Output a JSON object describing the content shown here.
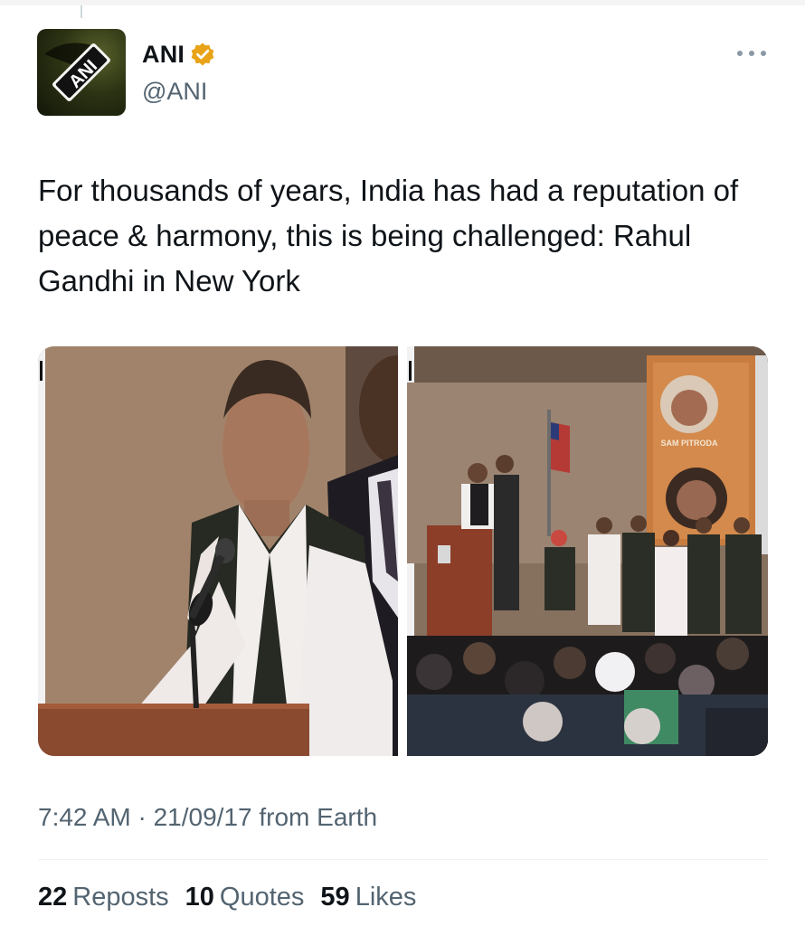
{
  "post": {
    "author": {
      "name": "ANI",
      "handle": "@ANI",
      "verified_icon": "verified-badge-icon",
      "verified_color": "#E8A317",
      "avatar_logo_text": "ANI"
    },
    "text": "For thousands of years, India has had a reputation of peace & harmony, this is being challenged: Rahul Gandhi in New York",
    "media": {
      "count": 2,
      "right_banner_text": "SAM PITRODA"
    },
    "timestamp": "7:42 AM · 21/09/17 from Earth",
    "stats": {
      "reposts_count": "22",
      "reposts_label": "Reposts",
      "quotes_count": "10",
      "quotes_label": "Quotes",
      "likes_count": "59",
      "likes_label": "Likes"
    },
    "more_icon": "more-horizontal-icon"
  }
}
